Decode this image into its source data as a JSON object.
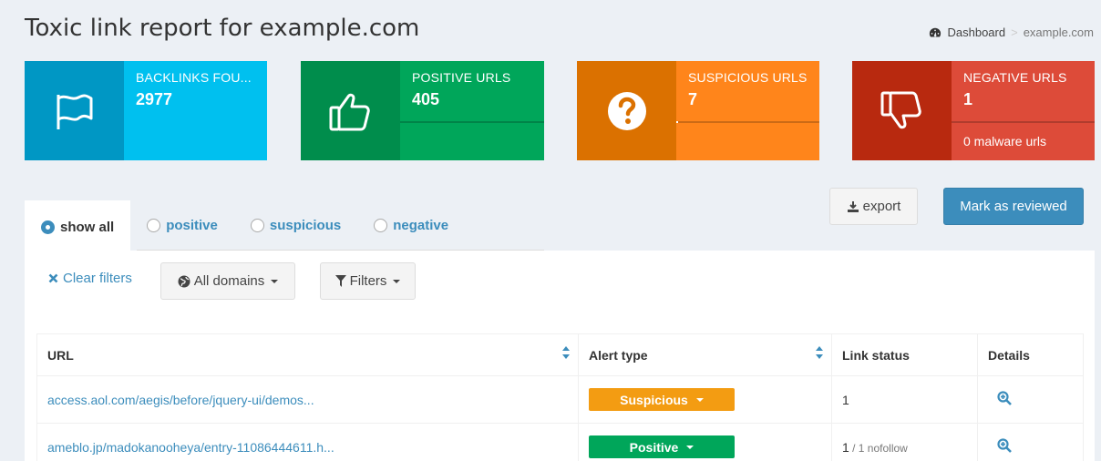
{
  "title": "Toxic link report for example.com",
  "breadcrumb": {
    "home": "Dashboard",
    "current": "example.com"
  },
  "boxes": [
    {
      "label": "BACKLINKS FOU...",
      "number": "2977",
      "desc": "",
      "icon": "flag-icon",
      "iconBg": "#0097c4",
      "bg": "#00c0ef",
      "progress": 1.0
    },
    {
      "label": "POSITIVE URLS",
      "number": "405",
      "desc": "",
      "icon": "thumbs-up-icon",
      "iconBg": "#008d4c",
      "bg": "#00a65a",
      "progress": 0
    },
    {
      "label": "SUSPICIOUS URLS",
      "number": "7",
      "desc": "",
      "icon": "question-circle-icon",
      "iconBg": "#db7100",
      "bg": "#ff851b",
      "progress": 0.01
    },
    {
      "label": "NEGATIVE URLS",
      "number": "1",
      "desc": "0 malware urls",
      "icon": "thumbs-down-icon",
      "iconBg": "#b8290f",
      "bg": "#dd4b39",
      "progress": 0
    }
  ],
  "tabs": [
    {
      "label": "show all",
      "active": true
    },
    {
      "label": "positive",
      "active": false
    },
    {
      "label": "suspicious",
      "active": false
    },
    {
      "label": "negative",
      "active": false
    }
  ],
  "actions": {
    "export": "export",
    "review": "Mark as reviewed"
  },
  "filters": {
    "clear": "Clear filters",
    "domains": "All domains",
    "filters": "Filters"
  },
  "table": {
    "headers": [
      "URL",
      "Alert type",
      "Link status",
      "Details"
    ],
    "rows": [
      {
        "url": "access.aol.com/aegis/before/jquery-ui/demos...",
        "alert": "Suspicious",
        "alertColor": "#f39c12",
        "status": "1",
        "status_extra": ""
      },
      {
        "url": "ameblo.jp/madokanooheya/entry-11086444611.h...",
        "alert": "Positive",
        "alertColor": "#00a65a",
        "status": "1",
        "status_extra": " / 1 nofollow"
      }
    ]
  }
}
